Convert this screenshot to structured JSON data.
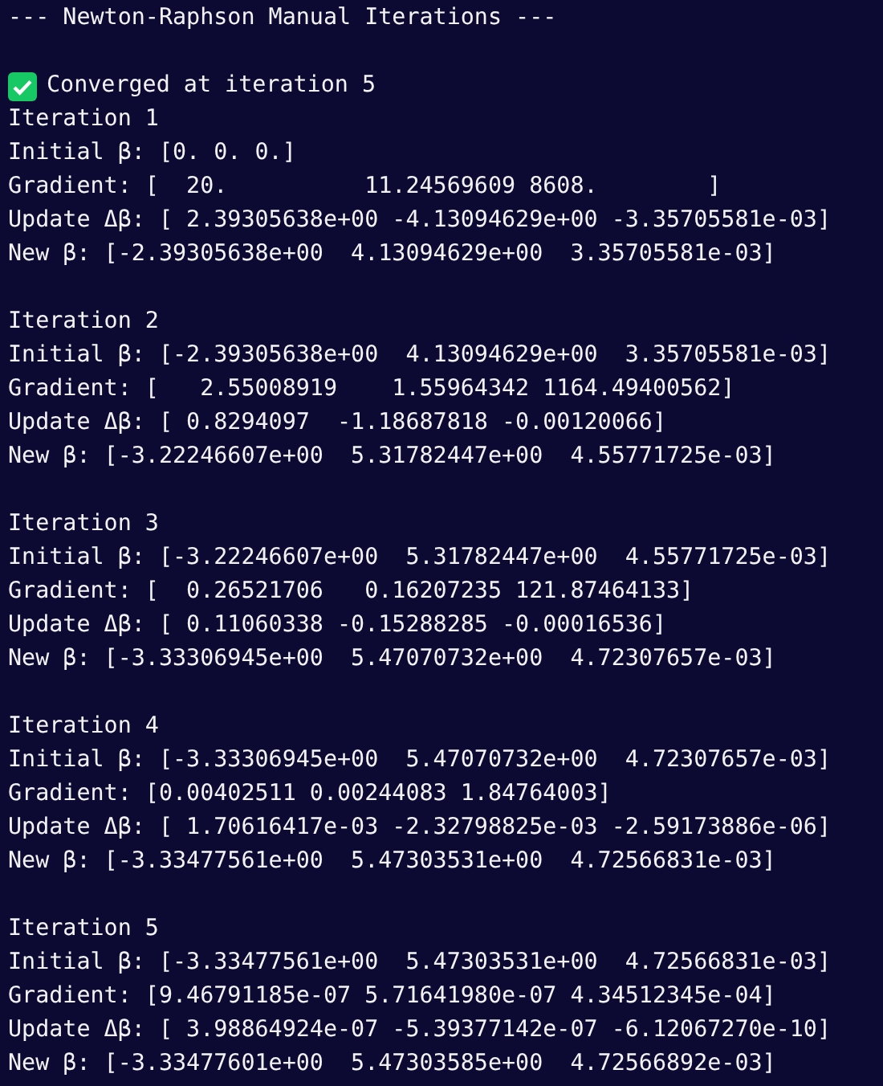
{
  "title": "--- Newton-Raphson Manual Iterations ---",
  "status": {
    "text": "Converged at iteration 5",
    "success": true
  },
  "iterations": [
    {
      "heading": "Iteration 1",
      "lines": [
        "Initial β: [0. 0. 0.]",
        "Gradient: [  20.          11.24569609 8608.        ]",
        "Update Δβ: [ 2.39305638e+00 -4.13094629e+00 -3.35705581e-03]",
        "New β: [-2.39305638e+00  4.13094629e+00  3.35705581e-03]"
      ]
    },
    {
      "heading": "Iteration 2",
      "lines": [
        "Initial β: [-2.39305638e+00  4.13094629e+00  3.35705581e-03]",
        "Gradient: [   2.55008919    1.55964342 1164.49400562]",
        "Update Δβ: [ 0.8294097  -1.18687818 -0.00120066]",
        "New β: [-3.22246607e+00  5.31782447e+00  4.55771725e-03]"
      ]
    },
    {
      "heading": "Iteration 3",
      "lines": [
        "Initial β: [-3.22246607e+00  5.31782447e+00  4.55771725e-03]",
        "Gradient: [  0.26521706   0.16207235 121.87464133]",
        "Update Δβ: [ 0.11060338 -0.15288285 -0.00016536]",
        "New β: [-3.33306945e+00  5.47070732e+00  4.72307657e-03]"
      ]
    },
    {
      "heading": "Iteration 4",
      "lines": [
        "Initial β: [-3.33306945e+00  5.47070732e+00  4.72307657e-03]",
        "Gradient: [0.00402511 0.00244083 1.84764003]",
        "Update Δβ: [ 1.70616417e-03 -2.32798825e-03 -2.59173886e-06]",
        "New β: [-3.33477561e+00  5.47303531e+00  4.72566831e-03]"
      ]
    },
    {
      "heading": "Iteration 5",
      "lines": [
        "Initial β: [-3.33477561e+00  5.47303531e+00  4.72566831e-03]",
        "Gradient: [9.46791185e-07 5.71641980e-07 4.34512345e-04]",
        "Update Δβ: [ 3.98864924e-07 -5.39377142e-07 -6.12067270e-10]",
        "New β: [-3.33477601e+00  5.47303585e+00  4.72566892e-03]"
      ]
    }
  ]
}
